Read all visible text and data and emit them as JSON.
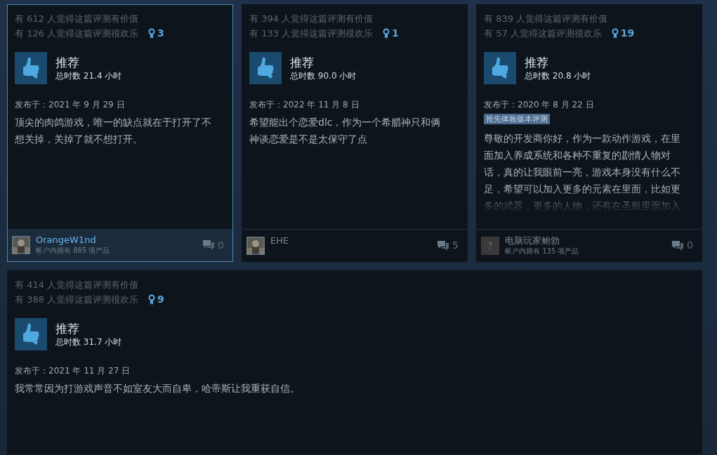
{
  "reviews": [
    {
      "selected": true,
      "helpful": "有 612 人觉得这篇评测有价值",
      "funny": "有 126 人觉得这篇评测很欢乐",
      "awards": "3",
      "verdict": "推荐",
      "playtime": "总时数 21.4 小时",
      "posted": "发布于：2021 年 9 月 29 日",
      "text": "顶尖的肉鸽游戏，唯一的缺点就在于打开了不想关掉，关掉了就不想打开。",
      "author": {
        "name": "OrangeW1nd",
        "owned": "帐户内拥有 885 项产品"
      },
      "comments": "0"
    },
    {
      "selected": false,
      "helpful": "有 394 人觉得这篇评测有价值",
      "funny": "有 133 人觉得这篇评测很欢乐",
      "awards": "1",
      "verdict": "推荐",
      "playtime": "总时数 90.0 小时",
      "posted": "发布于：2022 年 11 月 8 日",
      "text": "希望能出个恋爱dlc，作为一个希腊神只和俩神谈恋爱是不是太保守了点",
      "author": {
        "name": "EHE"
      },
      "comments": "5"
    },
    {
      "selected": false,
      "helpful": "有 839 人觉得这篇评测有价值",
      "funny": "有 57 人觉得这篇评测很欢乐",
      "awards": "19",
      "verdict": "推荐",
      "playtime": "总时数 20.8 小时",
      "posted": "发布于：2020 年 8 月 22 日",
      "tag": "抢先体验版本评测",
      "text": "尊敬的开发商你好，作为一款动作游戏，在里面加入养成系统和各种不重复的剧情人物对话，真的让我眼前一亮，游戏本身没有什么不足，希望可以加入更多的元素在里面，比如更多的武器，更多的人物，还有在圣殿里面加入",
      "author": {
        "name": "电脑玩家鲍勃",
        "avatar": {
          "kind": "placeholder",
          "mark": "?"
        },
        "owned": "帐户内拥有 135 项产品"
      },
      "comments": "0"
    },
    {
      "selected": false,
      "helpful": "有 414 人觉得这篇评测有价值",
      "funny": "有 388 人觉得这篇评测很欢乐",
      "awards": "9",
      "verdict": "推荐",
      "playtime": "总时数 31.7 小时",
      "posted": "发布于：2021 年 11 月 27 日",
      "text": "我常常因为打游戏声音不如室友大而自卑，哈帝斯让我重获自信。"
    }
  ]
}
